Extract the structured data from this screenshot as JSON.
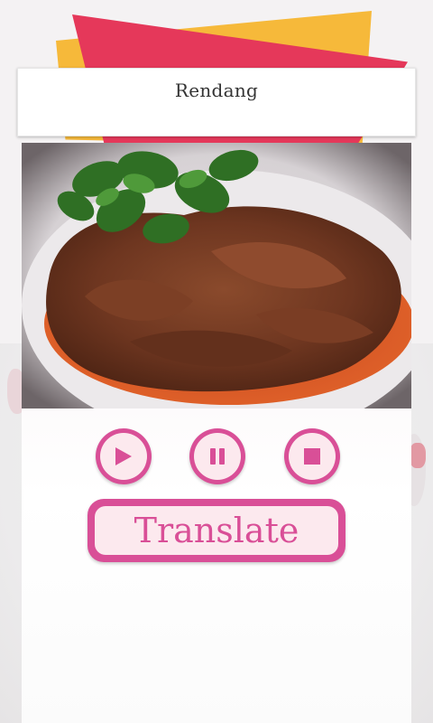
{
  "header": {
    "title": "Rendang"
  },
  "photo": {
    "subject": "rendang dish photo"
  },
  "controls": {
    "play_icon": "play-icon",
    "pause_icon": "pause-icon",
    "stop_icon": "stop-icon"
  },
  "translate": {
    "label": "Translate"
  },
  "colors": {
    "accent": "#d94f97",
    "button_fill": "#fce9ee",
    "ribbon_red": "#e5385a",
    "ribbon_yellow": "#f6b93a"
  }
}
